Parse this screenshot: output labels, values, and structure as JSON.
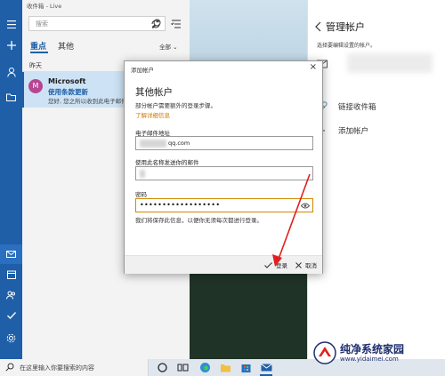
{
  "mail": {
    "window_title": "收件箱 - Live",
    "search_placeholder": "搜索",
    "tabs": [
      {
        "label": "重点",
        "active": true
      },
      {
        "label": "其他",
        "active": false
      }
    ],
    "filter_label": "全部 ⌄",
    "date_header": "昨天",
    "message": {
      "avatar_letter": "M",
      "sender": "Microsoft",
      "subject": "使用条款更新",
      "preview": "您好, 您之所以收到此电子邮件..."
    }
  },
  "panel": {
    "title": "管理帐户",
    "description": "选择要编辑设置的帐户。",
    "link_inboxes": "链接收件箱",
    "add_account": "添加帐户"
  },
  "dialog": {
    "caption": "添加帐户",
    "title": "其他帐户",
    "subtitle": "部分帐户需要额外的登录步骤。",
    "learn_more": "了解详细信息",
    "email_label": "电子邮件地址",
    "email_value": "qq.com",
    "name_label": "使用此名称发送你的邮件",
    "password_label": "密码",
    "password_value": "••••••••••••••••••",
    "save_note": "我们将保存此信息，以便你无须每次都进行登录。",
    "signin_label": "登录",
    "cancel_label": "取消"
  },
  "taskbar": {
    "search_placeholder": "在这里输入你要搜索的内容"
  },
  "watermark": {
    "name": "纯净系统家园",
    "url": "www.yidaimei.com"
  },
  "colors": {
    "accent": "#1e5fa8",
    "link_orange": "#d07a00",
    "annotation_red": "#e02020"
  }
}
